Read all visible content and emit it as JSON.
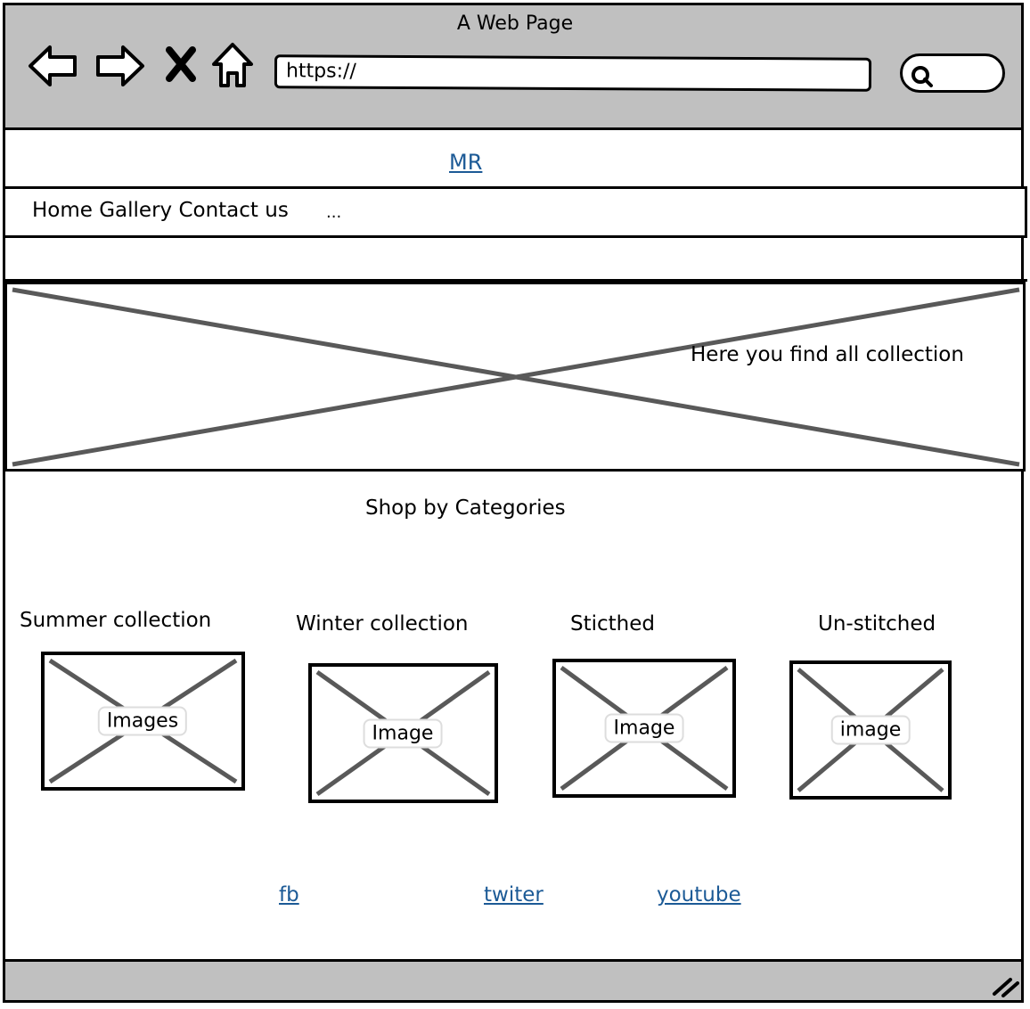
{
  "window": {
    "title": "A Web Page"
  },
  "browser": {
    "address_value": "https://",
    "back_icon": "back-arrow-icon",
    "forward_icon": "forward-arrow-icon",
    "stop_icon": "close-icon",
    "home_icon": "home-icon",
    "search_icon": "search-icon"
  },
  "site": {
    "logo": "MR"
  },
  "nav": {
    "items_label": "Home Gallery Contact us",
    "more": "..."
  },
  "hero": {
    "text": "Here you find all collection"
  },
  "categories": {
    "heading": "Shop by Categories",
    "items": [
      {
        "title": "Summer collection",
        "image_label": "Images"
      },
      {
        "title": "Winter collection",
        "image_label": "Image"
      },
      {
        "title": "Sticthed",
        "image_label": "Image"
      },
      {
        "title": "Un-stitched",
        "image_label": "image"
      }
    ]
  },
  "footer": {
    "links": [
      "fb",
      "twiter",
      "youtube"
    ]
  },
  "colors": {
    "chrome": "#c0c0c0",
    "link": "#1c5a96",
    "placeholder_stroke": "#595959"
  }
}
